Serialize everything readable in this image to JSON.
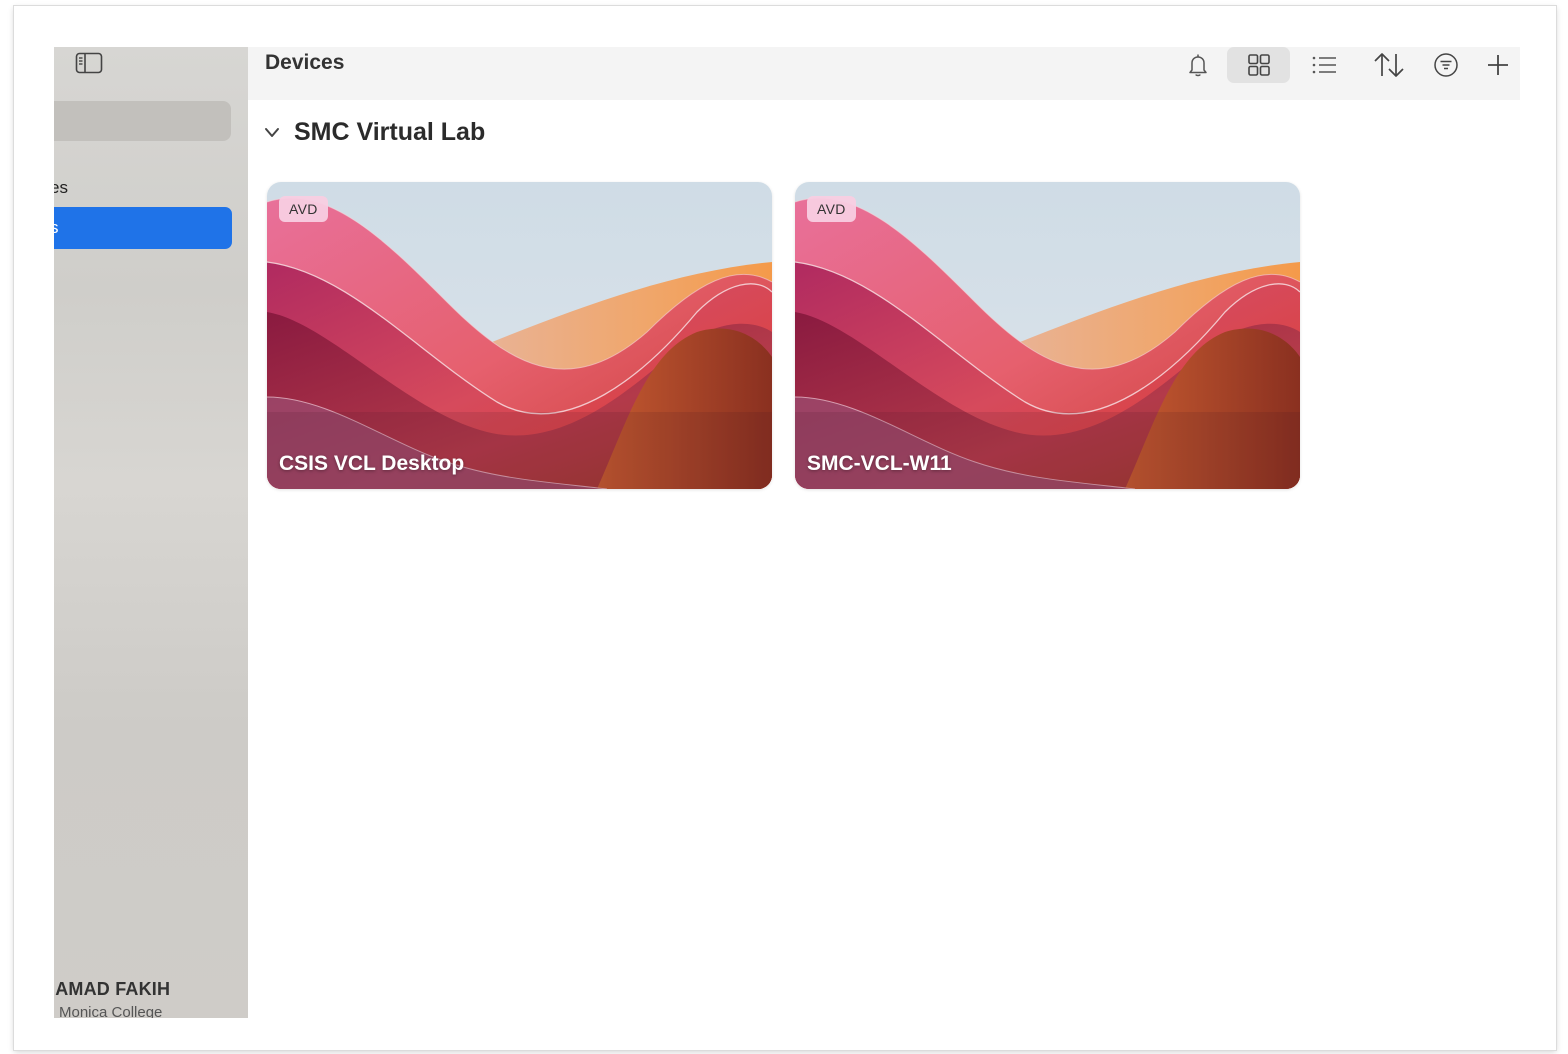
{
  "sidebar": {
    "items": [
      {
        "label": "es"
      },
      {
        "label": "s"
      }
    ],
    "user": {
      "name": "IAMAD FAKIH",
      "org": "Monica College"
    }
  },
  "toolbar": {
    "title": "Devices",
    "buttons": [
      {
        "icon": "bell-icon"
      },
      {
        "icon": "grid-view-icon",
        "active": true
      },
      {
        "icon": "list-view-icon"
      },
      {
        "icon": "sort-icon"
      },
      {
        "icon": "filter-icon"
      },
      {
        "icon": "plus-icon"
      }
    ]
  },
  "main": {
    "group": {
      "title": "SMC Virtual Lab",
      "cards": [
        {
          "badge": "AVD",
          "title": "CSIS VCL Desktop"
        },
        {
          "badge": "AVD",
          "title": "SMC-VCL-W11"
        }
      ]
    }
  },
  "colors": {
    "accent": "#1f73e8",
    "sidebar_bg": "#d3d1cd",
    "toolbar_bg": "#f4f4f4",
    "badge_bg": "#f8cde1"
  }
}
